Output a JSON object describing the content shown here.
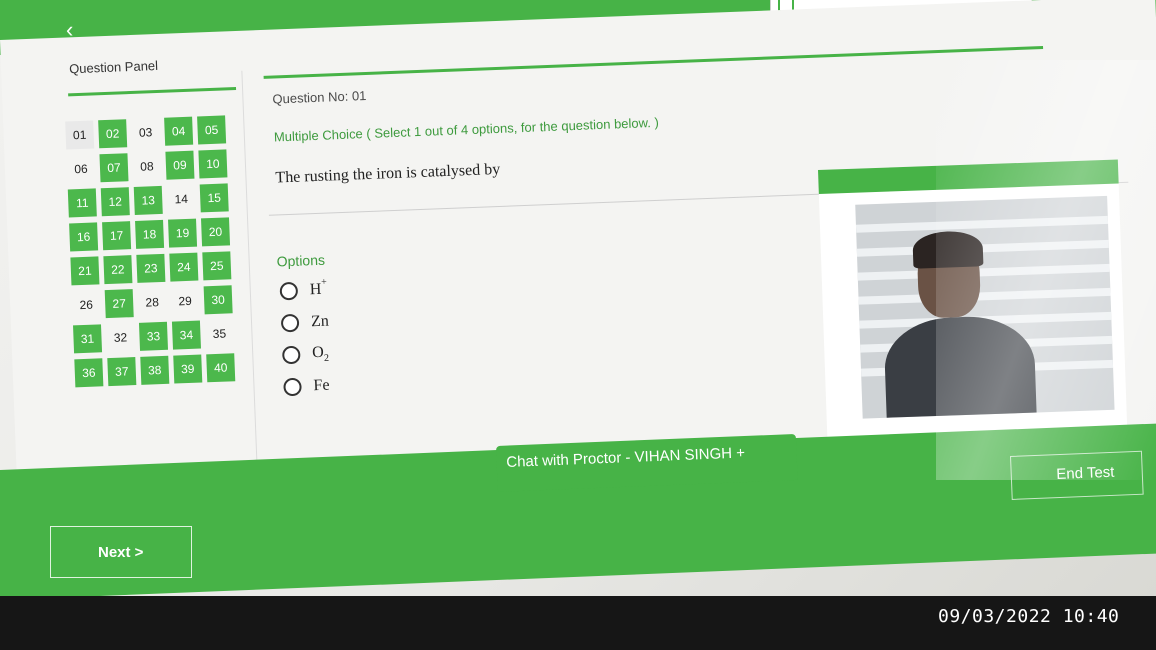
{
  "app": {
    "back_icon": "chevron-left-icon",
    "accent_color": "#47b347"
  },
  "question_panel": {
    "title": "Question Panel",
    "questions": [
      {
        "label": "01",
        "state": "current"
      },
      {
        "label": "02",
        "state": "answered"
      },
      {
        "label": "03",
        "state": "unanswered"
      },
      {
        "label": "04",
        "state": "answered"
      },
      {
        "label": "05",
        "state": "answered"
      },
      {
        "label": "06",
        "state": "unanswered"
      },
      {
        "label": "07",
        "state": "answered"
      },
      {
        "label": "08",
        "state": "unanswered"
      },
      {
        "label": "09",
        "state": "answered"
      },
      {
        "label": "10",
        "state": "answered"
      },
      {
        "label": "11",
        "state": "answered"
      },
      {
        "label": "12",
        "state": "answered"
      },
      {
        "label": "13",
        "state": "answered"
      },
      {
        "label": "14",
        "state": "unanswered"
      },
      {
        "label": "15",
        "state": "answered"
      },
      {
        "label": "16",
        "state": "answered"
      },
      {
        "label": "17",
        "state": "answered"
      },
      {
        "label": "18",
        "state": "answered"
      },
      {
        "label": "19",
        "state": "answered"
      },
      {
        "label": "20",
        "state": "answered"
      },
      {
        "label": "21",
        "state": "answered"
      },
      {
        "label": "22",
        "state": "answered"
      },
      {
        "label": "23",
        "state": "answered"
      },
      {
        "label": "24",
        "state": "answered"
      },
      {
        "label": "25",
        "state": "answered"
      },
      {
        "label": "26",
        "state": "unanswered"
      },
      {
        "label": "27",
        "state": "answered"
      },
      {
        "label": "28",
        "state": "unanswered"
      },
      {
        "label": "29",
        "state": "unanswered"
      },
      {
        "label": "30",
        "state": "answered"
      },
      {
        "label": "31",
        "state": "answered"
      },
      {
        "label": "32",
        "state": "unanswered"
      },
      {
        "label": "33",
        "state": "answered"
      },
      {
        "label": "34",
        "state": "answered"
      },
      {
        "label": "35",
        "state": "unanswered"
      },
      {
        "label": "36",
        "state": "answered"
      },
      {
        "label": "37",
        "state": "answered"
      },
      {
        "label": "38",
        "state": "answered"
      },
      {
        "label": "39",
        "state": "answered"
      },
      {
        "label": "40",
        "state": "answered"
      }
    ]
  },
  "question": {
    "number": "Question No: 01",
    "type": "Multiple Choice ( Select 1 out of 4 options, for the question below. )",
    "text": "The rusting the iron is catalysed by",
    "options_label": "Options",
    "options": [
      {
        "base": "H",
        "sup": "+",
        "sub": ""
      },
      {
        "base": "Zn",
        "sup": "",
        "sub": ""
      },
      {
        "base": "O",
        "sup": "",
        "sub": "2"
      },
      {
        "base": "Fe",
        "sup": "",
        "sub": ""
      }
    ]
  },
  "footer": {
    "chat_label": "Chat with Proctor - VIHAN SINGH  +",
    "end_label": "End Test",
    "next_label": "Next >"
  },
  "overlay": {
    "timestamp": "09/03/2022 10:40"
  }
}
